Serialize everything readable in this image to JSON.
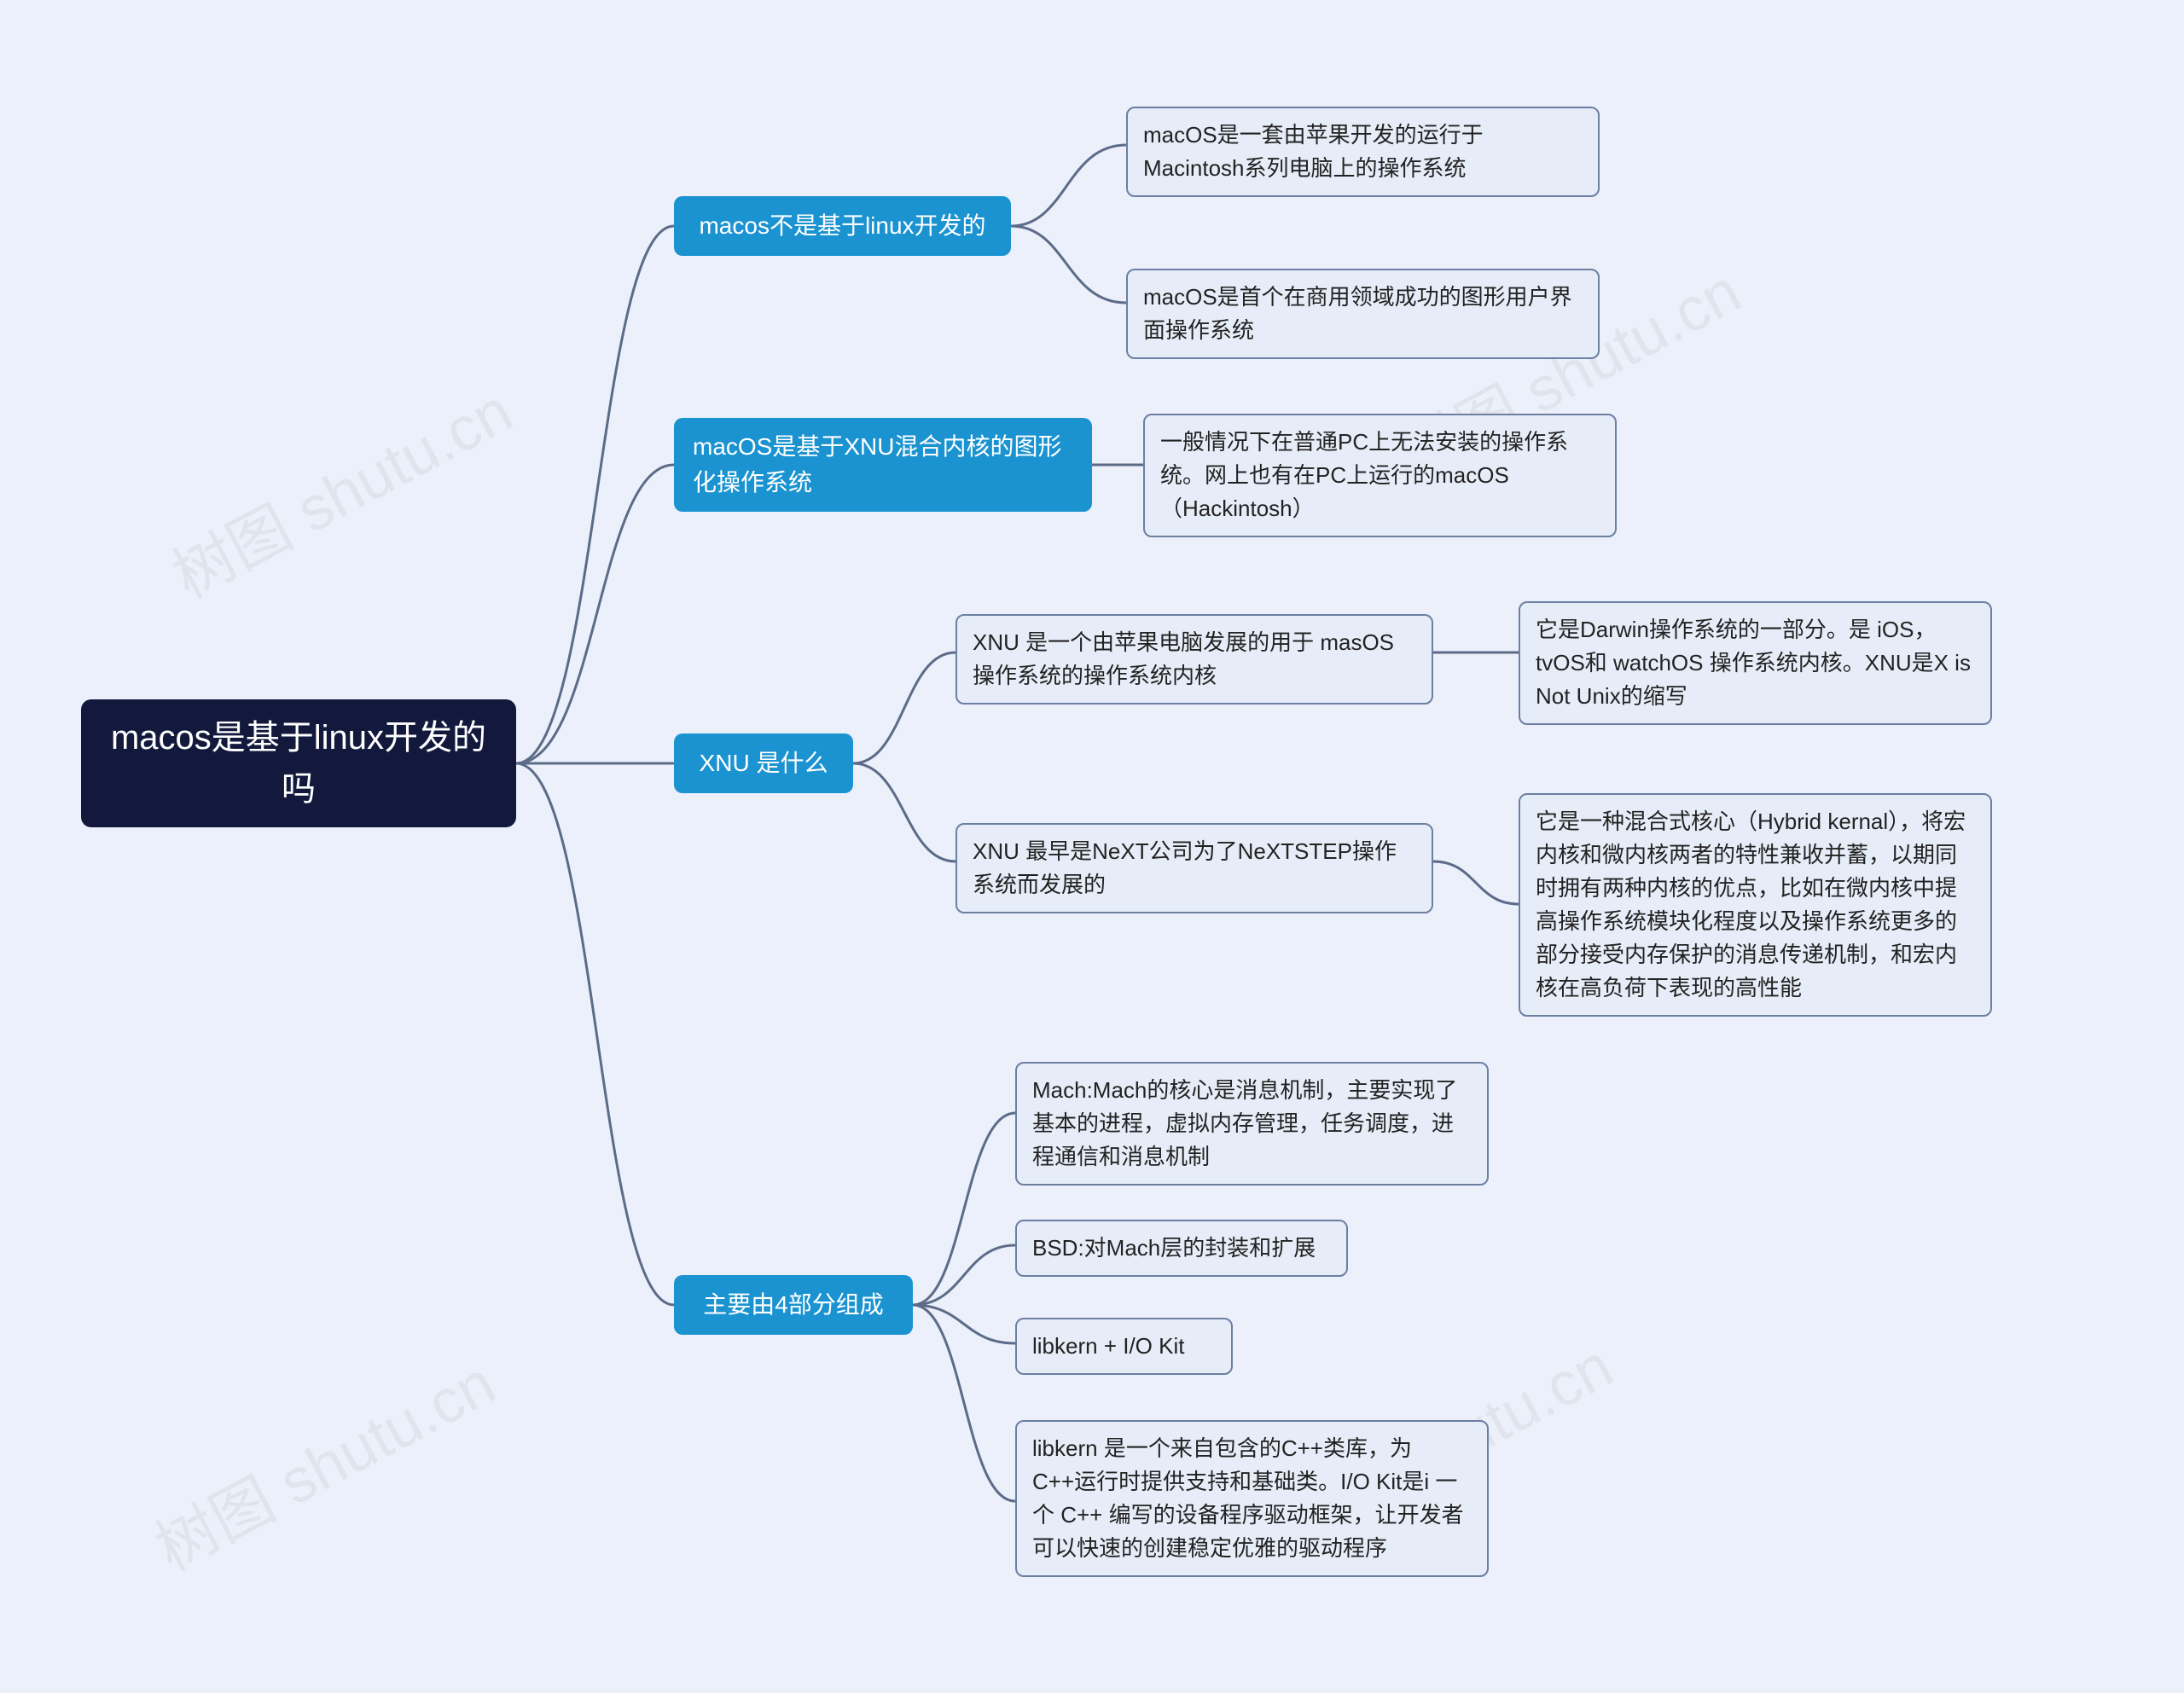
{
  "watermark_text": "树图 shutu.cn",
  "root": {
    "text": "macos是基于linux开发的吗"
  },
  "branches": [
    {
      "id": "b1",
      "text": "macos不是基于linux开发的",
      "children": [
        {
          "id": "b1c1",
          "text": "macOS是一套由苹果开发的运行于Macintosh系列电脑上的操作系统"
        },
        {
          "id": "b1c2",
          "text": "macOS是首个在商用领域成功的图形用户界面操作系统"
        }
      ]
    },
    {
      "id": "b2",
      "text": "macOS是基于XNU混合内核的图形化操作系统",
      "children": [
        {
          "id": "b2c1",
          "text": "一般情况下在普通PC上无法安装的操作系统。网上也有在PC上运行的macOS（Hackintosh）"
        }
      ]
    },
    {
      "id": "b3",
      "text": "XNU 是什么",
      "children": [
        {
          "id": "b3c1",
          "text": "XNU 是一个由苹果电脑发展的用于 masOS 操作系统的操作系统内核",
          "children": [
            {
              "id": "b3c1g1",
              "text": "它是Darwin操作系统的一部分。是 iOS，tvOS和 watchOS 操作系统内核。XNU是X is Not Unix的缩写"
            }
          ]
        },
        {
          "id": "b3c2",
          "text": "XNU 最早是NeXT公司为了NeXTSTEP操作系统而发展的",
          "children": [
            {
              "id": "b3c2g1",
              "text": "它是一种混合式核心（Hybrid kernal），将宏内核和微内核两者的特性兼收并蓄，以期同时拥有两种内核的优点，比如在微内核中提高操作系统模块化程度以及操作系统更多的部分接受内存保护的消息传递机制，和宏内核在高负荷下表现的高性能"
            }
          ]
        }
      ]
    },
    {
      "id": "b4",
      "text": "主要由4部分组成",
      "children": [
        {
          "id": "b4c1",
          "text": "Mach:Mach的核心是消息机制，主要实现了基本的进程，虚拟内存管理，任务调度，进程通信和消息机制"
        },
        {
          "id": "b4c2",
          "text": "BSD:对Mach层的封装和扩展"
        },
        {
          "id": "b4c3",
          "text": "libkern + I/O Kit"
        },
        {
          "id": "b4c4",
          "text": "libkern 是一个来自包含的C++类库，为C++运行时提供支持和基础类。I/O Kit是i 一个 C++ 编写的设备程序驱动框架，让开发者可以快速的创建稳定优雅的驱动程序"
        }
      ]
    }
  ]
}
